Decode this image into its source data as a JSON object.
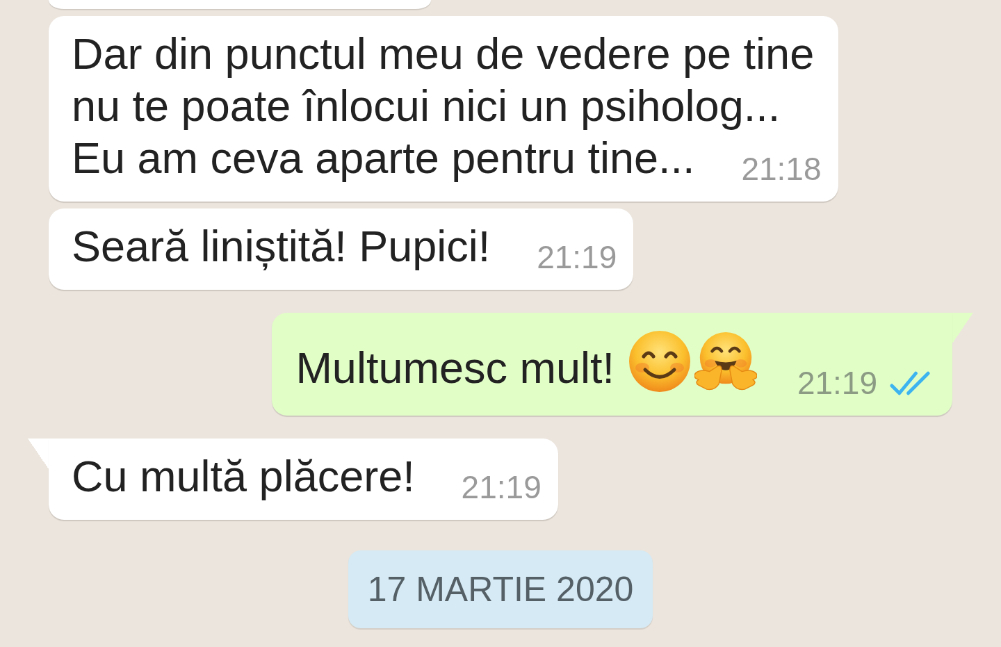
{
  "messages": [
    {
      "outgoing": false,
      "cut_off": true
    },
    {
      "outgoing": false,
      "cut_off": false,
      "tail": false,
      "lines": [
        "Dar din punctul meu de vedere pe tine",
        "nu te poate înlocui nici un psiholog...",
        "Eu am ceva aparte pentru tine..."
      ],
      "time": "21:18"
    },
    {
      "outgoing": false,
      "cut_off": false,
      "tail": false,
      "lines": [
        "Seară liniștită! Pupici!"
      ],
      "time": "21:19"
    },
    {
      "outgoing": true,
      "cut_off": false,
      "tail": true,
      "lines": [
        "Multumesc mult!"
      ],
      "emoji": [
        {
          "kind": "smiling"
        },
        {
          "kind": "hugging"
        }
      ],
      "time": "21:19",
      "read": true
    },
    {
      "outgoing": false,
      "cut_off": false,
      "tail": true,
      "lines": [
        "Cu multă plăcere!"
      ],
      "time": "21:19"
    }
  ],
  "date_divider": {
    "text": "17 MARTIE 2020"
  }
}
